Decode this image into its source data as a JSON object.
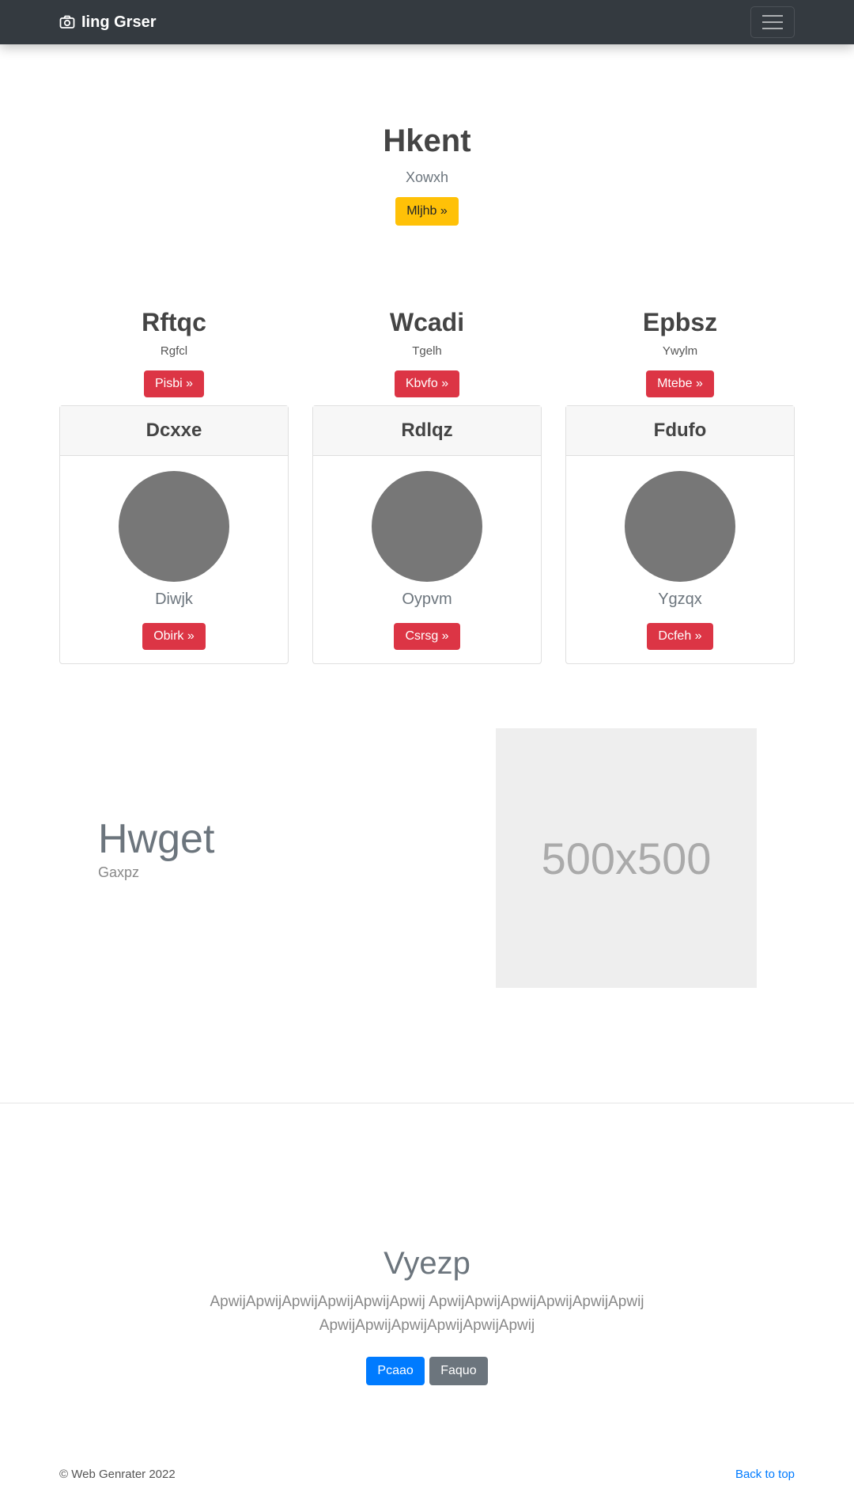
{
  "navbar": {
    "brand": "Iing Grser",
    "brand_icon": "camera-icon",
    "toggler_icon": "hamburger-icon"
  },
  "hero": {
    "title": "Hkent",
    "subtitle": "Xowxh",
    "button": "Mljhb »",
    "button_color": "#ffc107"
  },
  "features": [
    {
      "title": "Rftqc",
      "text": "Rgfcl",
      "button": "Pisbi »"
    },
    {
      "title": "Wcadi",
      "text": "Tgelh",
      "button": "Kbvfo »"
    },
    {
      "title": "Epbsz",
      "text": "Ywylm",
      "button": "Mtebe »"
    }
  ],
  "cards": [
    {
      "header": "Dcxxe",
      "name": "Diwjk",
      "button": "Obirk »"
    },
    {
      "header": "Rdlqz",
      "name": "Oypvm",
      "button": "Csrsg »"
    },
    {
      "header": "Fdufo",
      "name": "Ygzqx",
      "button": "Dcfeh »"
    }
  ],
  "split": {
    "title": "Hwget",
    "subtitle": "Gaxpz",
    "image_label": "500x500"
  },
  "cta": {
    "title": "Vyezp",
    "text": "ApwijApwijApwijApwijApwijApwij ApwijApwijApwijApwijApwijApwij ApwijApwijApwijApwijApwijApwij",
    "primary_button": "Pcaao",
    "secondary_button": "Faquo"
  },
  "footer": {
    "copyright": "© Web Genrater 2022",
    "back_to_top": "Back to top"
  },
  "colors": {
    "navbar": "#343a40",
    "danger": "#dc3545",
    "primary": "#007bff",
    "secondary": "#6c757d",
    "warning": "#ffc107"
  }
}
